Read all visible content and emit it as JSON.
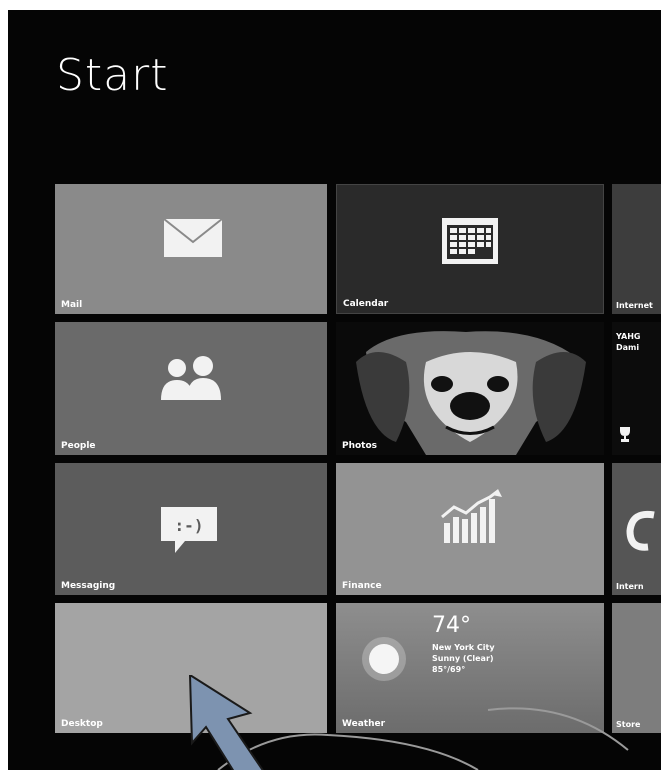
{
  "start": {
    "title": "Start"
  },
  "tiles": {
    "mail": {
      "label": "Mail",
      "icon": "envelope-icon"
    },
    "calendar": {
      "label": "Calendar",
      "icon": "calendar-icon"
    },
    "people": {
      "label": "People",
      "icon": "people-icon"
    },
    "photos": {
      "label": "Photos",
      "icon": "dog-photo"
    },
    "messaging": {
      "label": "Messaging",
      "icon": "chat-bubble-icon"
    },
    "finance": {
      "label": "Finance",
      "icon": "chart-icon"
    },
    "desktop": {
      "label": "Desktop"
    },
    "weather": {
      "label": "Weather",
      "temperature": "74°",
      "city": "New York City",
      "condition": "Sunny (Clear)",
      "hi_lo": "85°/69°",
      "icon": "sun-icon"
    },
    "col3": {
      "top_label": "Internet",
      "games_line1": "YAHG",
      "games_line2": "Dami",
      "ie_label": "Intern",
      "store_label": "Store"
    }
  },
  "colors": {
    "background": "#050505",
    "tile_light": "#a4a4a4",
    "tile_dark": "#2a2a2a",
    "arrow": "#7d93b0"
  }
}
